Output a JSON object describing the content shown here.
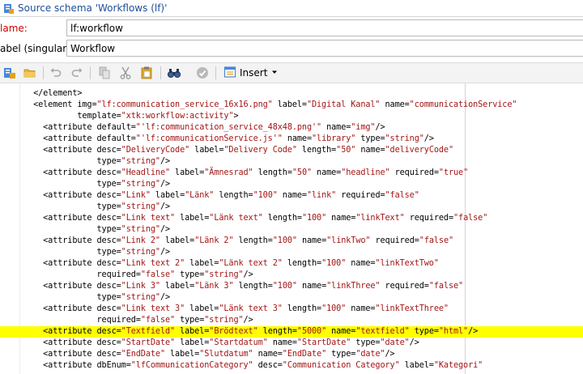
{
  "window": {
    "title": "Source schema 'Workflows (lf)'"
  },
  "form": {
    "name_label": "lame:",
    "name_value": "lf:workflow",
    "label_singular_label": "abel (singular):",
    "label_singular_value": "Workflow"
  },
  "toolbar": {
    "insert_label": "Insert",
    "icons": [
      "new-schema-icon",
      "open-folder-icon",
      "undo-icon",
      "redo-icon",
      "copy-icon",
      "cut-icon",
      "paste-icon",
      "find-icon",
      "check-icon",
      "insert-icon"
    ]
  },
  "colors": {
    "string": "#a31515",
    "highlight": "#ffff00",
    "required_label": "#cc0000",
    "title": "#1e4e9b"
  },
  "code_lines": [
    {
      "text": "  </element>",
      "highlight": false
    },
    {
      "text": "  <element img=\"lf:communication_service_16x16.png\" label=\"Digital Kanal\" name=\"communicationService\"",
      "highlight": false
    },
    {
      "text": "           template=\"xtk:workflow:activity\">",
      "highlight": false
    },
    {
      "text": "    <attribute default=\"'lf:communication_service_48x48.png'\" name=\"img\"/>",
      "highlight": false
    },
    {
      "text": "    <attribute default=\"'lf:communicationService.js'\" name=\"library\" type=\"string\"/>",
      "highlight": false
    },
    {
      "text": "    <attribute desc=\"DeliveryCode\" label=\"Delivery Code\" length=\"50\" name=\"deliveryCode\"",
      "highlight": false
    },
    {
      "text": "               type=\"string\"/>",
      "highlight": false
    },
    {
      "text": "    <attribute desc=\"Headline\" label=\"Ämnesrad\" length=\"50\" name=\"headline\" required=\"true\"",
      "highlight": false
    },
    {
      "text": "               type=\"string\"/>",
      "highlight": false
    },
    {
      "text": "    <attribute desc=\"Link\" label=\"Länk\" length=\"100\" name=\"link\" required=\"false\"",
      "highlight": false
    },
    {
      "text": "               type=\"string\"/>",
      "highlight": false
    },
    {
      "text": "    <attribute desc=\"Link text\" label=\"Länk text\" length=\"100\" name=\"linkText\" required=\"false\"",
      "highlight": false
    },
    {
      "text": "               type=\"string\"/>",
      "highlight": false
    },
    {
      "text": "    <attribute desc=\"Link 2\" label=\"Länk 2\" length=\"100\" name=\"linkTwo\" required=\"false\"",
      "highlight": false
    },
    {
      "text": "               type=\"string\"/>",
      "highlight": false
    },
    {
      "text": "    <attribute desc=\"Link text 2\" label=\"Länk text 2\" length=\"100\" name=\"linkTextTwo\"",
      "highlight": false
    },
    {
      "text": "               required=\"false\" type=\"string\"/>",
      "highlight": false
    },
    {
      "text": "    <attribute desc=\"Link 3\" label=\"Länk 3\" length=\"100\" name=\"linkThree\" required=\"false\"",
      "highlight": false
    },
    {
      "text": "               type=\"string\"/>",
      "highlight": false
    },
    {
      "text": "    <attribute desc=\"Link text 3\" label=\"Länk text 3\" length=\"100\" name=\"linkTextThree\"",
      "highlight": false
    },
    {
      "text": "               required=\"false\" type=\"string\"/>",
      "highlight": false
    },
    {
      "text": "    <attribute desc=\"Textfield\" label=\"Brödtext\" length=\"5000\" name=\"textfield\" type=\"html\"/>",
      "highlight": true
    },
    {
      "text": "    <attribute desc=\"StartDate\" label=\"Startdatum\" name=\"StartDate\" type=\"date\"/>",
      "highlight": false
    },
    {
      "text": "    <attribute desc=\"EndDate\" label=\"Slutdatum\" name=\"EndDate\" type=\"date\"/>",
      "highlight": false
    },
    {
      "text": "    <attribute dbEnum=\"lfCommunicationCategory\" desc=\"Communication Category\" label=\"Kategori\"",
      "highlight": false
    }
  ]
}
